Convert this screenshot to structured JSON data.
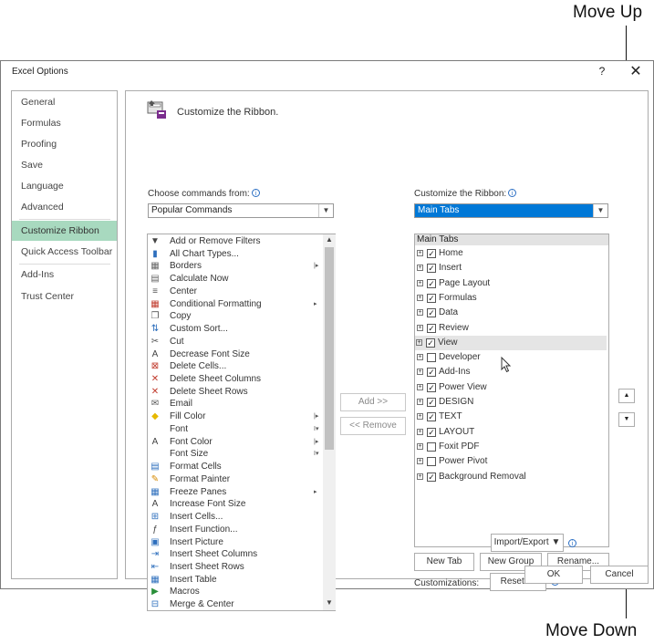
{
  "callouts": {
    "move_up": "Move Up",
    "move_down": "Move Down"
  },
  "dialog": {
    "title": "Excel Options",
    "help": "?",
    "close": "✕"
  },
  "nav": {
    "items": [
      {
        "label": "General"
      },
      {
        "label": "Formulas"
      },
      {
        "label": "Proofing"
      },
      {
        "label": "Save"
      },
      {
        "label": "Language"
      },
      {
        "label": "Advanced"
      },
      {
        "label": "Customize Ribbon",
        "selected": true
      },
      {
        "label": "Quick Access Toolbar"
      },
      {
        "label": "Add-Ins"
      },
      {
        "label": "Trust Center"
      }
    ]
  },
  "header": {
    "title": "Customize the Ribbon."
  },
  "left_panel": {
    "label": "Choose commands from:",
    "combo_value": "Popular Commands",
    "commands": [
      {
        "label": "Add or Remove Filters",
        "icon": "▼",
        "color": "#444"
      },
      {
        "label": "All Chart Types...",
        "icon": "▮",
        "color": "#2e6fbd"
      },
      {
        "label": "Borders",
        "icon": "▦",
        "color": "#666",
        "sub": "|▸"
      },
      {
        "label": "Calculate Now",
        "icon": "▤",
        "color": "#666"
      },
      {
        "label": "Center",
        "icon": "≡",
        "color": "#555"
      },
      {
        "label": "Conditional Formatting",
        "icon": "▦",
        "color": "#c0392b",
        "sub": "▸"
      },
      {
        "label": "Copy",
        "icon": "❐",
        "color": "#555"
      },
      {
        "label": "Custom Sort...",
        "icon": "⇅",
        "color": "#2e6fbd"
      },
      {
        "label": "Cut",
        "icon": "✂",
        "color": "#555"
      },
      {
        "label": "Decrease Font Size",
        "icon": "A",
        "color": "#444"
      },
      {
        "label": "Delete Cells...",
        "icon": "⊠",
        "color": "#c0392b"
      },
      {
        "label": "Delete Sheet Columns",
        "icon": "✕",
        "color": "#c0392b"
      },
      {
        "label": "Delete Sheet Rows",
        "icon": "✕",
        "color": "#c0392b"
      },
      {
        "label": "Email",
        "icon": "✉",
        "color": "#555"
      },
      {
        "label": "Fill Color",
        "icon": "◆",
        "color": "#e6b800",
        "sub": "|▸"
      },
      {
        "label": "Font",
        "icon": "",
        "color": "#444",
        "sub": "I▾"
      },
      {
        "label": "Font Color",
        "icon": "A",
        "color": "#444",
        "sub": "|▸"
      },
      {
        "label": "Font Size",
        "icon": "",
        "color": "#444",
        "sub": "I▾"
      },
      {
        "label": "Format Cells",
        "icon": "▤",
        "color": "#2e6fbd"
      },
      {
        "label": "Format Painter",
        "icon": "✎",
        "color": "#d68a00"
      },
      {
        "label": "Freeze Panes",
        "icon": "▦",
        "color": "#2e6fbd",
        "sub": "▸"
      },
      {
        "label": "Increase Font Size",
        "icon": "A",
        "color": "#444"
      },
      {
        "label": "Insert Cells...",
        "icon": "⊞",
        "color": "#2e6fbd"
      },
      {
        "label": "Insert Function...",
        "icon": "ƒ",
        "color": "#444"
      },
      {
        "label": "Insert Picture",
        "icon": "▣",
        "color": "#2e6fbd"
      },
      {
        "label": "Insert Sheet Columns",
        "icon": "⇥",
        "color": "#2e6fbd"
      },
      {
        "label": "Insert Sheet Rows",
        "icon": "⇤",
        "color": "#2e6fbd"
      },
      {
        "label": "Insert Table",
        "icon": "▦",
        "color": "#2e6fbd"
      },
      {
        "label": "Macros",
        "icon": "▶",
        "color": "#2a8f3a"
      },
      {
        "label": "Merge & Center",
        "icon": "⊟",
        "color": "#2e6fbd"
      }
    ]
  },
  "middle": {
    "add_label": "Add >>",
    "remove_label": "<< Remove"
  },
  "right_panel": {
    "label": "Customize the Ribbon:",
    "combo_value": "Main Tabs",
    "tree_header": "Main Tabs",
    "tabs": [
      {
        "label": "Home",
        "checked": true
      },
      {
        "label": "Insert",
        "checked": true
      },
      {
        "label": "Page Layout",
        "checked": true
      },
      {
        "label": "Formulas",
        "checked": true
      },
      {
        "label": "Data",
        "checked": true
      },
      {
        "label": "Review",
        "checked": true
      },
      {
        "label": "View",
        "checked": true,
        "selected": true
      },
      {
        "label": "Developer",
        "checked": false
      },
      {
        "label": "Add-Ins",
        "checked": true
      },
      {
        "label": "Power View",
        "checked": true
      },
      {
        "label": "DESIGN",
        "checked": true
      },
      {
        "label": "TEXT",
        "checked": true
      },
      {
        "label": "LAYOUT",
        "checked": true
      },
      {
        "label": "Foxit PDF",
        "checked": false
      },
      {
        "label": "Power Pivot",
        "checked": false
      },
      {
        "label": "Background Removal",
        "checked": true
      }
    ],
    "new_tab": "New Tab",
    "new_group": "New Group",
    "rename": "Rename...",
    "customizations_label": "Customizations:",
    "reset": "Reset ▼",
    "import_export": "Import/Export ▼"
  },
  "footer": {
    "ok": "OK",
    "cancel": "Cancel"
  },
  "colors": {
    "nav_selected": "#a8d9bf",
    "combo_selected": "#0078d7",
    "info": "#2b6fc4"
  }
}
